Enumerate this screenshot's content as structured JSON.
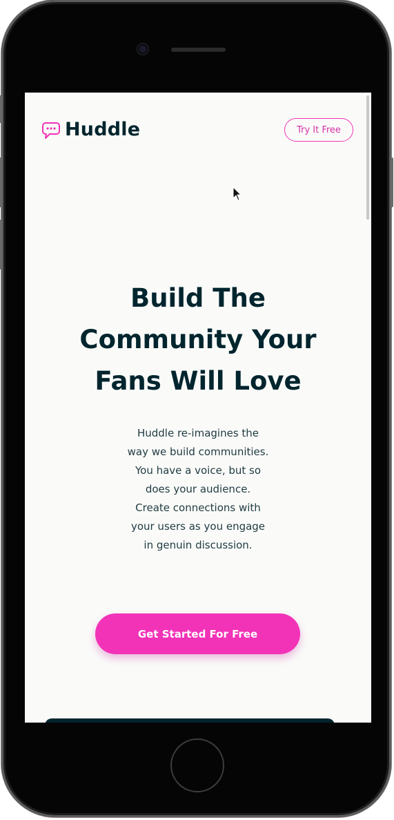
{
  "brand": {
    "name": "Huddle",
    "accent": "#f233b8",
    "dark": "#00252e"
  },
  "header": {
    "cta_label": "Try It Free"
  },
  "hero": {
    "title": "Build The Community Your Fans Will Love",
    "body": "Huddle re-imagines the way we build communities. You have a voice, but so does your audience. Create connections with your users as you engage in genuin discussion.",
    "cta_label": "Get Started For Free"
  }
}
